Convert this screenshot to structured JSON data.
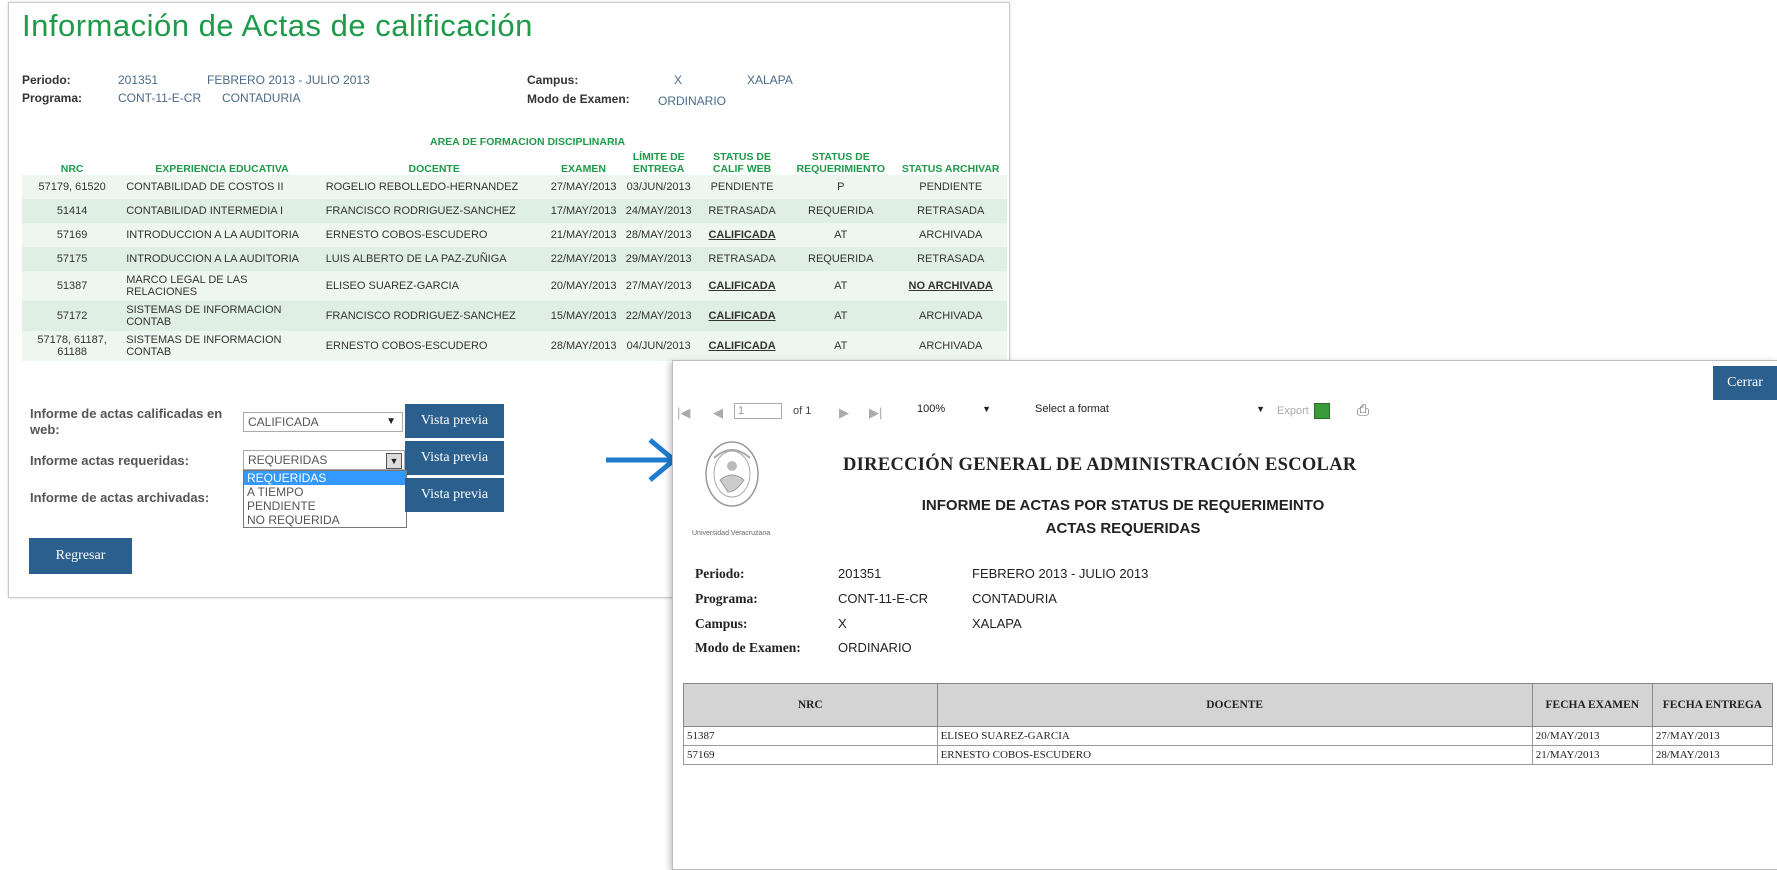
{
  "page": {
    "title": "Información de Actas de calificación",
    "periodo_label": "Periodo:",
    "periodo_code": "201351",
    "periodo_range": "FEBRERO 2013 - JULIO 2013",
    "programa_label": "Programa:",
    "programa_code": "CONT-11-E-CR",
    "programa_name": "CONTADURIA",
    "campus_label": "Campus:",
    "campus_code": "X",
    "campus_name": "XALAPA",
    "modo_label": "Modo de Examen:",
    "modo_value": "ORDINARIO"
  },
  "table": {
    "area_heading": "AREA DE FORMACION DISCIPLINARIA",
    "headers": [
      "NRC",
      "EXPERIENCIA EDUCATIVA",
      "DOCENTE",
      "EXAMEN",
      "LÍMITE DE ENTREGA",
      "STATUS DE CALIF WEB",
      "STATUS DE REQUERIMIENTO",
      "STATUS ARCHIVAR"
    ],
    "rows": [
      {
        "nrc": "57179, 61520",
        "ee": "CONTABILIDAD DE COSTOS II",
        "docente": "ROGELIO REBOLLEDO-HERNANDEZ",
        "examen": "27/MAY/2013",
        "limite": "03/JUN/2013",
        "calif": "PENDIENTE",
        "req": "P",
        "arch": "PENDIENTE"
      },
      {
        "nrc": "51414",
        "ee": "CONTABILIDAD INTERMEDIA I",
        "docente": "FRANCISCO RODRIGUEZ-SANCHEZ",
        "examen": "17/MAY/2013",
        "limite": "24/MAY/2013",
        "calif": "RETRASADA",
        "req": "REQUERIDA",
        "arch": "RETRASADA"
      },
      {
        "nrc": "57169",
        "ee": "INTRODUCCION A LA AUDITORIA",
        "docente": "ERNESTO COBOS-ESCUDERO",
        "examen": "21/MAY/2013",
        "limite": "28/MAY/2013",
        "calif": "CALIFICADA",
        "req": "AT",
        "arch": "ARCHIVADA"
      },
      {
        "nrc": "57175",
        "ee": "INTRODUCCION A LA AUDITORIA",
        "docente": "LUIS ALBERTO DE LA PAZ-ZUÑIGA",
        "examen": "22/MAY/2013",
        "limite": "29/MAY/2013",
        "calif": "RETRASADA",
        "req": "REQUERIDA",
        "arch": "RETRASADA"
      },
      {
        "nrc": "51387",
        "ee": "MARCO LEGAL DE LAS RELACIONES",
        "docente": "ELISEO SUAREZ-GARCIA",
        "examen": "20/MAY/2013",
        "limite": "27/MAY/2013",
        "calif": "CALIFICADA",
        "req": "AT",
        "arch": "NO ARCHIVADA"
      },
      {
        "nrc": "57172",
        "ee": "SISTEMAS DE INFORMACION CONTAB",
        "docente": "FRANCISCO RODRIGUEZ-SANCHEZ",
        "examen": "15/MAY/2013",
        "limite": "22/MAY/2013",
        "calif": "CALIFICADA",
        "req": "AT",
        "arch": "ARCHIVADA"
      },
      {
        "nrc": "57178, 61187, 61188",
        "ee": "SISTEMAS DE INFORMACION CONTAB",
        "docente": "ERNESTO COBOS-ESCUDERO",
        "examen": "28/MAY/2013",
        "limite": "04/JUN/2013",
        "calif": "CALIFICADA",
        "req": "AT",
        "arch": "ARCHIVADA"
      }
    ]
  },
  "reports": {
    "calificadas_label": "Informe de actas calificadas en web:",
    "calificadas_value": "CALIFICADA",
    "requeridas_label": "Informe actas requeridas:",
    "requeridas_value": "REQUERIDAS",
    "archivadas_label": "Informe de actas archivadas:",
    "vista_previa": "Vista previa",
    "dropdown_options": [
      "REQUERIDAS",
      "A TIEMPO",
      "PENDIENTE",
      "NO REQUERIDA"
    ],
    "regresar": "Regresar"
  },
  "viewer": {
    "close_label": "Cerrar",
    "page_input": "1",
    "of_label": "of 1",
    "zoom": "100%",
    "format_placeholder": "Select a format",
    "export_label": "Export",
    "university_caption": "Universidad Veracruzana",
    "heading1": "DIRECCIÓN GENERAL DE ADMINISTRACIÓN ESCOLAR",
    "heading2": "INFORME DE ACTAS POR STATUS DE REQUERIMEINTO",
    "heading3": "ACTAS REQUERIDAS",
    "periodo_label": "Periodo:",
    "periodo_code": "201351",
    "periodo_range": "FEBRERO 2013 - JULIO 2013",
    "programa_label": "Programa:",
    "programa_code": "CONT-11-E-CR",
    "programa_name": "CONTADURIA",
    "campus_label": "Campus:",
    "campus_code": "X",
    "campus_name": "XALAPA",
    "modo_label": "Modo de Examen:",
    "modo_value": "ORDINARIO",
    "table_headers": [
      "NRC",
      "DOCENTE",
      "FECHA EXAMEN",
      "FECHA ENTREGA"
    ],
    "table_rows": [
      {
        "nrc": "51387",
        "docente": "ELISEO SUAREZ-GARCIA",
        "examen": "20/MAY/2013",
        "entrega": "27/MAY/2013"
      },
      {
        "nrc": "57169",
        "docente": "ERNESTO COBOS-ESCUDERO",
        "examen": "21/MAY/2013",
        "entrega": "28/MAY/2013"
      }
    ]
  },
  "colors": {
    "title_green": "#1e9a4a",
    "button_blue": "#2a5f8e",
    "arrow_blue": "#1f7bd0",
    "row_light": "#eef6f0",
    "row_dark": "#dfefe3"
  }
}
